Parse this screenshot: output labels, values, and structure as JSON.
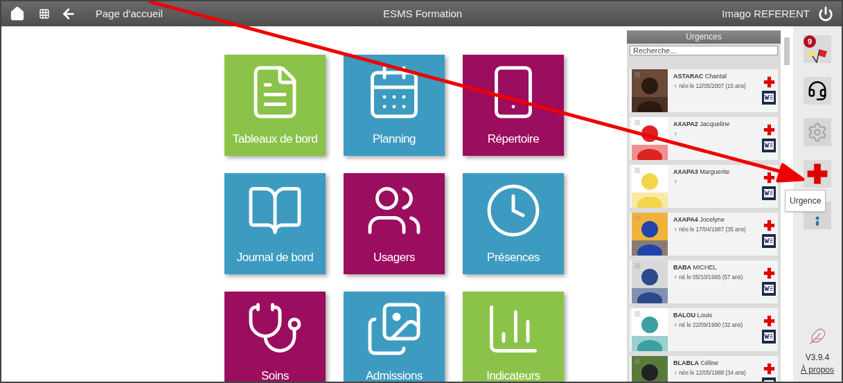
{
  "top_bar": {
    "page_title": "Page d'accueil",
    "app_title": "ESMS Formation",
    "user": "Imago REFERENT"
  },
  "tiles": [
    {
      "label": "Tableaux de bord",
      "color": "#8bc34a"
    },
    {
      "label": "Planning",
      "color": "#3d9bc1"
    },
    {
      "label": "Répertoire",
      "color": "#9b0d5e"
    },
    {
      "label": "Journal de bord",
      "color": "#3d9bc1"
    },
    {
      "label": "Usagers",
      "color": "#9b0d5e"
    },
    {
      "label": "Présences",
      "color": "#3d9bc1"
    },
    {
      "label": "Soins",
      "color": "#9b0d5e"
    },
    {
      "label": "Admissions",
      "color": "#3d9bc1"
    },
    {
      "label": "Indicateurs",
      "color": "#8bc34a"
    }
  ],
  "urgences": {
    "title": "Urgences",
    "search": {
      "placeholder": "Recherche..."
    },
    "patients": [
      {
        "last_name": "ASTARAC",
        "first_name": "Chantal",
        "info": "♀ née le 12/05/2007 (15 ans)"
      },
      {
        "last_name": "AXAPA2",
        "first_name": "Jacqueline",
        "info": "♀"
      },
      {
        "last_name": "AXAPA3",
        "first_name": "Marguerite",
        "info": "♀"
      },
      {
        "last_name": "AXAPA4",
        "first_name": "Jocelyne",
        "info": "♀ née le 17/04/1987 (35 ans)"
      },
      {
        "last_name": "BABA",
        "first_name": "MICHEL",
        "info": "♂ né le 05/10/1965 (57 ans)"
      },
      {
        "last_name": "BALOU",
        "first_name": "Louis",
        "info": "♂ né le 22/09/1990 (32 ans)"
      },
      {
        "last_name": "BLABLA",
        "first_name": "Céline",
        "info": "♀ née le 12/05/1988 (34 ans)"
      }
    ]
  },
  "side_bar": {
    "badge": "9",
    "tooltip": "Urgence",
    "version": "V3.9.4",
    "about": "À propos"
  }
}
